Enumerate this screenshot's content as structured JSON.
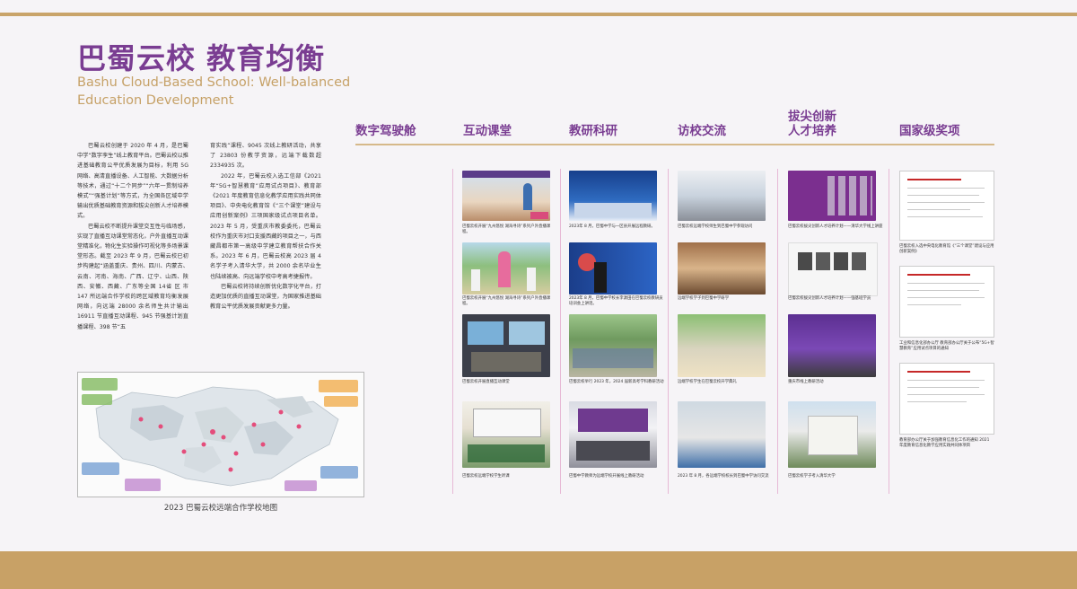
{
  "title": {
    "zh": "巴蜀云校 教育均衡",
    "en": "Bashu Cloud-Based School: Well-balanced Education Development"
  },
  "intro": {
    "col1": [
      "巴蜀云校创建于 2020 年 4 月，是巴蜀中学“数字孪生”线上教育平台。巴蜀云校以推进基础教育公平优质发展为目标，利用 5G 网络、高清直播设备、人工智能、大数据分析等技术，通过“十二个同步”“六年一贯制培养模式”“强基计划”等方式，为全国各区域中学输出优质基础教育资源和拔尖创新人才培养模式。",
      "巴蜀云校不断提升课堂交互性与临场感，实现了直播互动课堂常态化，户外直播互动课堂精准化，物化生实验操作可视化等多场景课堂形态。截至 2023 年 9 月，巴蜀云校已初步构建起“涵盖重庆、贵州、四川、内蒙古、云南、河南、海南、广西、辽宁、山西、陕西、安徽、西藏、广东等全国 14省 区 市 147 所远端合作学校的跨区域教育均衡发展网络，向远端 28000 余名师生共计输出 16911 节直播互动课程、945 节强基计划直播课程、398 节“五"
    ],
    "col2": [
      "育实践”课程、9045 次线上教研活动，共享了 23803 份教学资源，远端下载数超 2334935 次。",
      "2022 年，巴蜀云校入选工信部《2021年“5G+智慧教育”应用试点项目》、教育部《2021 年度教育信息化教学应用实践共同体项目》、中央电化教育馆《“三个课堂”建设与应用创新案例》三项国家级试点项目名单。2023 年 5 月，受重庆市教委委托，巴蜀云校作为重庆市对口支援西藏的项目之一，与西藏昌都市第一高级中学建立教育帮扶合作关系。2023 年 6 月，巴蜀云校高 2023 届 4 名学子考入清华大学，共 2000 余名毕业生也陆续被高、向远端学校中考高考捷报传。",
      "巴蜀云校将持续创新优化数字化平台，打造更加优质的直播互动课堂，为国家推进基础教育公平优质发展贡献更多力量。"
    ]
  },
  "map": {
    "caption": "2023 巴蜀云校远端合作学校地图",
    "cities": [
      "重庆",
      "贵州",
      "四川",
      "内蒙古",
      "云南",
      "河南",
      "海南",
      "广西",
      "辽宁",
      "山西",
      "陕西",
      "安徽",
      "西藏",
      "广东"
    ]
  },
  "headings": [
    "数字驾驶舱",
    "互动课堂",
    "教研科研",
    "访校交流",
    "拔尖创新人才培养",
    "国家级奖项"
  ],
  "headings_lines": [
    [
      "数字驾驶舱"
    ],
    [
      "互动课堂"
    ],
    [
      "教研科研"
    ],
    [
      "访校交流"
    ],
    [
      "拔尖创新",
      "人才培养"
    ],
    [
      "国家级奖项"
    ]
  ],
  "captions": {
    "c1": [
      "巴蜀云校开展“九州悠悦 湖海寻诗”系列户外直播课程。",
      "巴蜀云校开展“九州悠悦 湖海寻诗”系列户外直播课程。",
      "巴蜀云校开展直播互动课堂",
      "巴蜀云校远端学校学生听课"
    ],
    "c2": [
      "2023年 8 月，巴蜀中学与一区县开展远程教研。",
      "2023年 8 月，巴蜀中学校长李源田在巴蜀云校教研员培训会上讲话。",
      "巴蜀云校举行 2023 年，2024 届新高考学科教研活动",
      "巴蜀中学教师为远端学校开展线上教研活动"
    ],
    "c3": [
      "巴蜀云校远端学校师生到巴蜀中学参观访问",
      "远端学校学子到巴蜀中学研学",
      "远端学校学生在巴蜀云校开学典礼",
      "2023 年 8 月，各远端学校校长到巴蜀中学访问交流"
    ],
    "c4": [
      "巴蜀云校拔尖创新人才培养计划——清华大学线上讲座",
      "巴蜀云校拔尖创新人才培养计划——强基班学员",
      "重庆市线上教研活动",
      "巴蜀云校学子考入清华大学"
    ],
    "c5": [
      "巴蜀云校入选中央电化教育馆《“三个课堂”建设与应用创新案例》",
      "工业和信息化部办公厅 教育部办公厅关于公布“5G+智慧教育”应用试点项目的通知",
      "教育部办公厅关于加强教育信息化工作的通知 2021 年度教育信息化教学应用实践共同体项目"
    ]
  },
  "colors": {
    "accent": "#7a3d92",
    "gold": "#c6a167",
    "bar": "#c8a166",
    "divider": "#e7b9d6"
  }
}
